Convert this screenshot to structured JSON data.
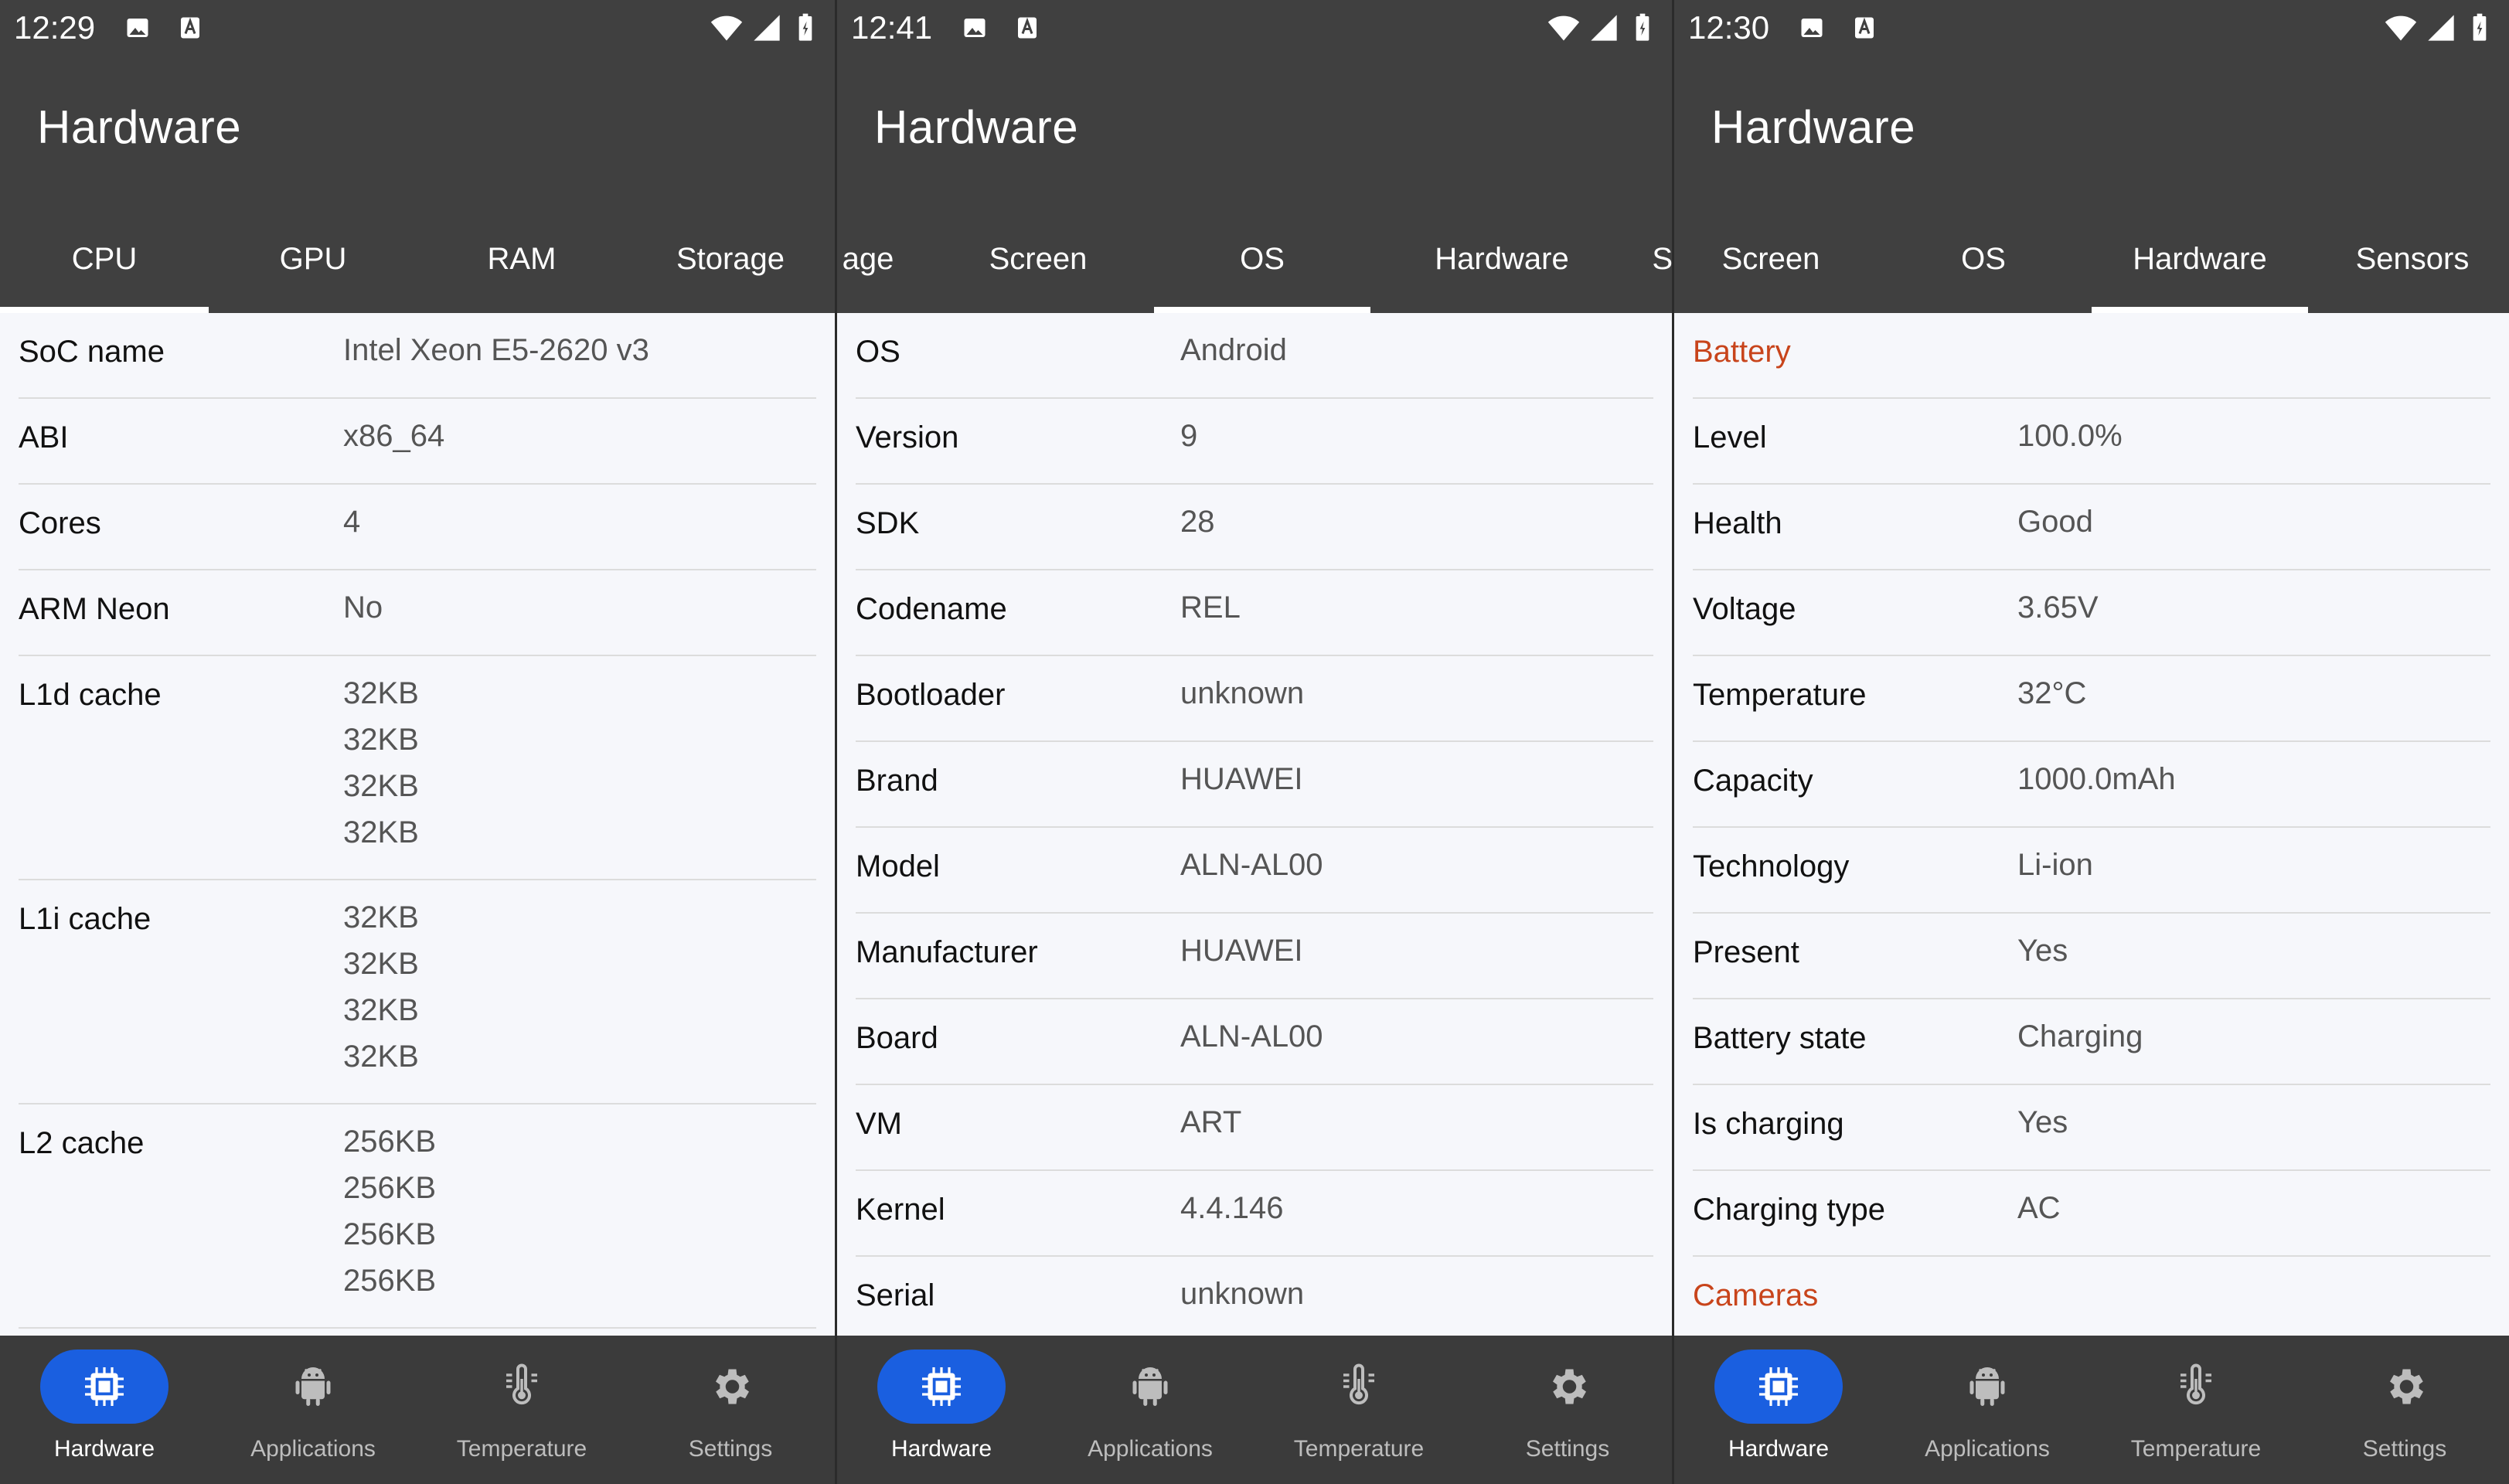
{
  "app_title": "Hardware",
  "screens": [
    {
      "status_time": "12:29",
      "tabs": [
        {
          "label": "CPU",
          "active": true
        },
        {
          "label": "GPU",
          "active": false
        },
        {
          "label": "RAM",
          "active": false
        },
        {
          "label": "Storage",
          "active": false
        }
      ],
      "rows": [
        {
          "key": "SoC name",
          "value": "Intel Xeon E5-2620 v3"
        },
        {
          "key": "ABI",
          "value": "x86_64"
        },
        {
          "key": "Cores",
          "value": "4"
        },
        {
          "key": "ARM Neon",
          "value": "No"
        },
        {
          "key": "L1d cache",
          "value": "32KB\n32KB\n32KB\n32KB"
        },
        {
          "key": "L1i cache",
          "value": "32KB\n32KB\n32KB\n32KB"
        },
        {
          "key": "L2 cache",
          "value": "256KB\n256KB\n256KB\n256KB"
        }
      ]
    },
    {
      "status_time": "12:41",
      "tabs": [
        {
          "label": "age",
          "active": false
        },
        {
          "label": "Screen",
          "active": false
        },
        {
          "label": "OS",
          "active": true
        },
        {
          "label": "Hardware",
          "active": false
        },
        {
          "label": "Sen",
          "active": false
        }
      ],
      "rows": [
        {
          "key": "OS",
          "value": "Android"
        },
        {
          "key": "Version",
          "value": "9"
        },
        {
          "key": "SDK",
          "value": "28"
        },
        {
          "key": "Codename",
          "value": "REL"
        },
        {
          "key": "Bootloader",
          "value": "unknown"
        },
        {
          "key": "Brand",
          "value": "HUAWEI"
        },
        {
          "key": "Model",
          "value": "ALN-AL00"
        },
        {
          "key": "Manufacturer",
          "value": "HUAWEI"
        },
        {
          "key": "Board",
          "value": "ALN-AL00"
        },
        {
          "key": "VM",
          "value": "ART"
        },
        {
          "key": "Kernel",
          "value": "4.4.146"
        },
        {
          "key": "Serial",
          "value": "unknown"
        }
      ]
    },
    {
      "status_time": "12:30",
      "tabs": [
        {
          "label": "Screen",
          "active": false
        },
        {
          "label": "OS",
          "active": false
        },
        {
          "label": "Hardware",
          "active": true
        },
        {
          "label": "Sensors",
          "active": false
        }
      ],
      "rows": [
        {
          "key": "Battery",
          "value": "",
          "section": true
        },
        {
          "key": "Level",
          "value": "100.0%"
        },
        {
          "key": "Health",
          "value": "Good"
        },
        {
          "key": "Voltage",
          "value": "3.65V"
        },
        {
          "key": "Temperature",
          "value": "32°C"
        },
        {
          "key": "Capacity",
          "value": "1000.0mAh"
        },
        {
          "key": "Technology",
          "value": "Li-ion"
        },
        {
          "key": "Present",
          "value": "Yes"
        },
        {
          "key": "Battery state",
          "value": "Charging"
        },
        {
          "key": "Is charging",
          "value": "Yes"
        },
        {
          "key": "Charging type",
          "value": "AC"
        },
        {
          "key": "Cameras",
          "value": "",
          "section": true
        }
      ]
    }
  ],
  "bottom_nav": [
    {
      "label": "Hardware",
      "icon": "chip-icon",
      "active": true
    },
    {
      "label": "Applications",
      "icon": "android-icon",
      "active": false
    },
    {
      "label": "Temperature",
      "icon": "thermometer-icon",
      "active": false
    },
    {
      "label": "Settings",
      "icon": "gear-icon",
      "active": false
    }
  ],
  "colors": {
    "appbar": "#404040",
    "section_title": "#c8441b",
    "nav_active_pill": "#1a5fe0"
  }
}
